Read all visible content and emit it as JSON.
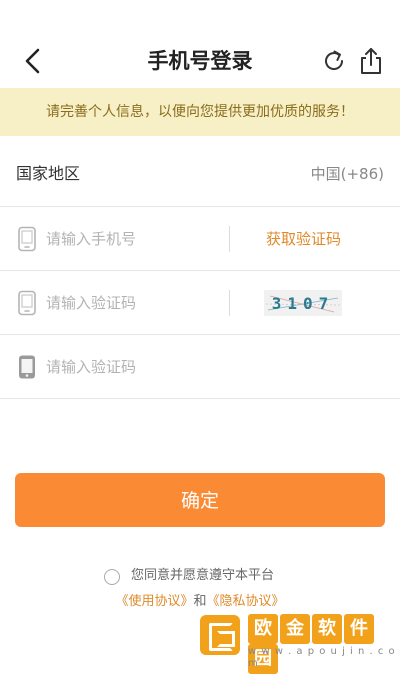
{
  "header": {
    "title": "手机号登录",
    "back_icon": "chevron-left-icon",
    "refresh_icon": "refresh-icon",
    "share_icon": "share-icon"
  },
  "notice": {
    "text": "请完善个人信息，以便向您提供更加优质的服务！"
  },
  "form": {
    "region_label": "国家地区",
    "region_value": "中国(+86)",
    "phone_placeholder": "请输入手机号",
    "get_code_label": "获取验证码",
    "captcha_placeholder": "请输入验证码",
    "captcha_text": "3107",
    "code_placeholder": "请输入验证码"
  },
  "confirm": {
    "label": "确定"
  },
  "agreement": {
    "text": "您同意并愿意遵守本平台",
    "terms": "《使用协议》",
    "and": "和",
    "privacy": "《隐私协议》"
  },
  "watermark": {
    "chars": [
      "欧",
      "金",
      "软",
      "件",
      "园"
    ],
    "url": "w w w . a p o u j i n . c o m"
  },
  "colors": {
    "accent": "#fb8a34",
    "link": "#e08a2a",
    "notice_bg": "#f7efc6",
    "notice_text": "#8a6d1c"
  }
}
